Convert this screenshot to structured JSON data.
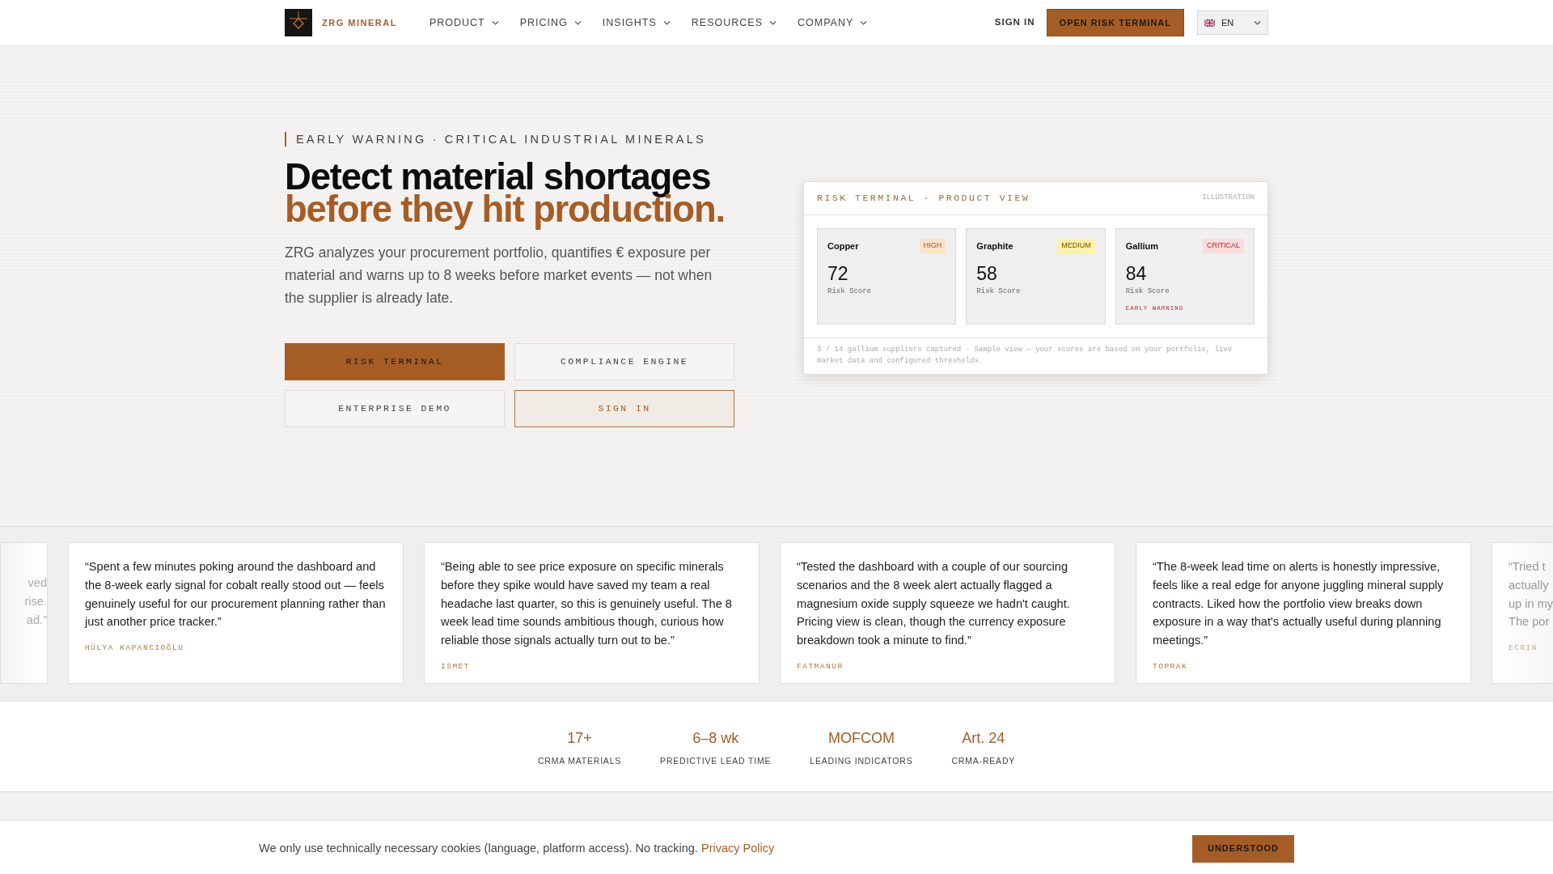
{
  "nav": {
    "brand": "ZRG MINERAL",
    "menu": [
      {
        "label": "PRODUCT"
      },
      {
        "label": "PRICING"
      },
      {
        "label": "INSIGHTS"
      },
      {
        "label": "RESOURCES"
      },
      {
        "label": "COMPANY"
      }
    ],
    "sign_in": "SIGN IN",
    "cta": "OPEN RISK TERMINAL",
    "language": "EN"
  },
  "hero": {
    "eyebrow": "EARLY WARNING · CRITICAL INDUSTRIAL MINERALS",
    "headline": "Detect material shortages",
    "headline_accent": "before they hit production.",
    "lead": "ZRG analyzes your procurement portfolio, quantifies € exposure per material and warns up to 8 weeks before market events — not when the supplier is already late.",
    "buttons": [
      {
        "label": "RISK TERMINAL",
        "kind": "primary"
      },
      {
        "label": "COMPLIANCE ENGINE",
        "kind": "outline"
      },
      {
        "label": "ENTERPRISE DEMO",
        "kind": "outline"
      },
      {
        "label": "SIGN IN",
        "kind": "accent"
      }
    ]
  },
  "terminal": {
    "title": "RISK TERMINAL · PRODUCT VIEW",
    "tag": "ILLUSTRATION",
    "materials": [
      {
        "name": "Copper",
        "badge": "HIGH",
        "kind": "high",
        "score": "72",
        "score_label": "Risk Score"
      },
      {
        "name": "Graphite",
        "badge": "MEDIUM",
        "kind": "medium",
        "score": "58",
        "score_label": "Risk Score"
      },
      {
        "name": "Gallium",
        "badge": "CRITICAL",
        "kind": "critical",
        "score": "84",
        "score_label": "Risk Score",
        "warning": "EARLY WARNING"
      }
    ],
    "footnote": "3 / 14 gallium suppliers captured · Sample view — your scores are based on your portfolio, live market data and configured thresholds."
  },
  "testimonials": [
    {
      "kind": "partial",
      "quote_lines": [
        "ved",
        "rise.",
        "ad.”"
      ]
    },
    {
      "kind": "full",
      "quote": "“Spent a few minutes poking around the dashboard and the 8-week early signal for cobalt really stood out — feels genuinely useful for our procurement planning rather than just another price tracker.”",
      "author": "HÜLYA KAPANCIOĞLU"
    },
    {
      "kind": "full",
      "quote": "“Being able to see price exposure on specific minerals before they spike would have saved my team a real headache last quarter, so this is genuinely useful. The 8 week lead time sounds ambitious though, curious how reliable those signals actually turn out to be.”",
      "author": "ISMET"
    },
    {
      "kind": "full",
      "quote": "“Tested the dashboard with a couple of our sourcing scenarios and the 8 week alert actually flagged a magnesium oxide supply squeeze we hadn't caught. Pricing view is clean, though the currency exposure breakdown took a minute to find.”",
      "author": "FATMANUR"
    },
    {
      "kind": "full",
      "quote": "“The 8-week lead time on alerts is honestly impressive, feels like a real edge for anyone juggling mineral supply contracts. Liked how the portfolio view breaks down exposure in a way that's actually useful during planning meetings.”",
      "author": "TOPRAK"
    },
    {
      "kind": "partial",
      "quote_lines": [
        "“Tried t",
        "actually",
        "up in my",
        "The por"
      ],
      "author": "ECRIN"
    }
  ],
  "stats": [
    {
      "value": "17+",
      "label": "CRMA MATERIALS"
    },
    {
      "value": "6–8 wk",
      "label": "PREDICTIVE LEAD TIME"
    },
    {
      "value": "MOFCOM",
      "label": "LEADING INDICATORS"
    },
    {
      "value": "Art. 24",
      "label": "CRMA-READY"
    }
  ],
  "cookie_bar": {
    "text": "We only use technically necessary cookies (language, platform access). No tracking.",
    "link": "Privacy Policy",
    "button": "UNDERSTOOD"
  }
}
